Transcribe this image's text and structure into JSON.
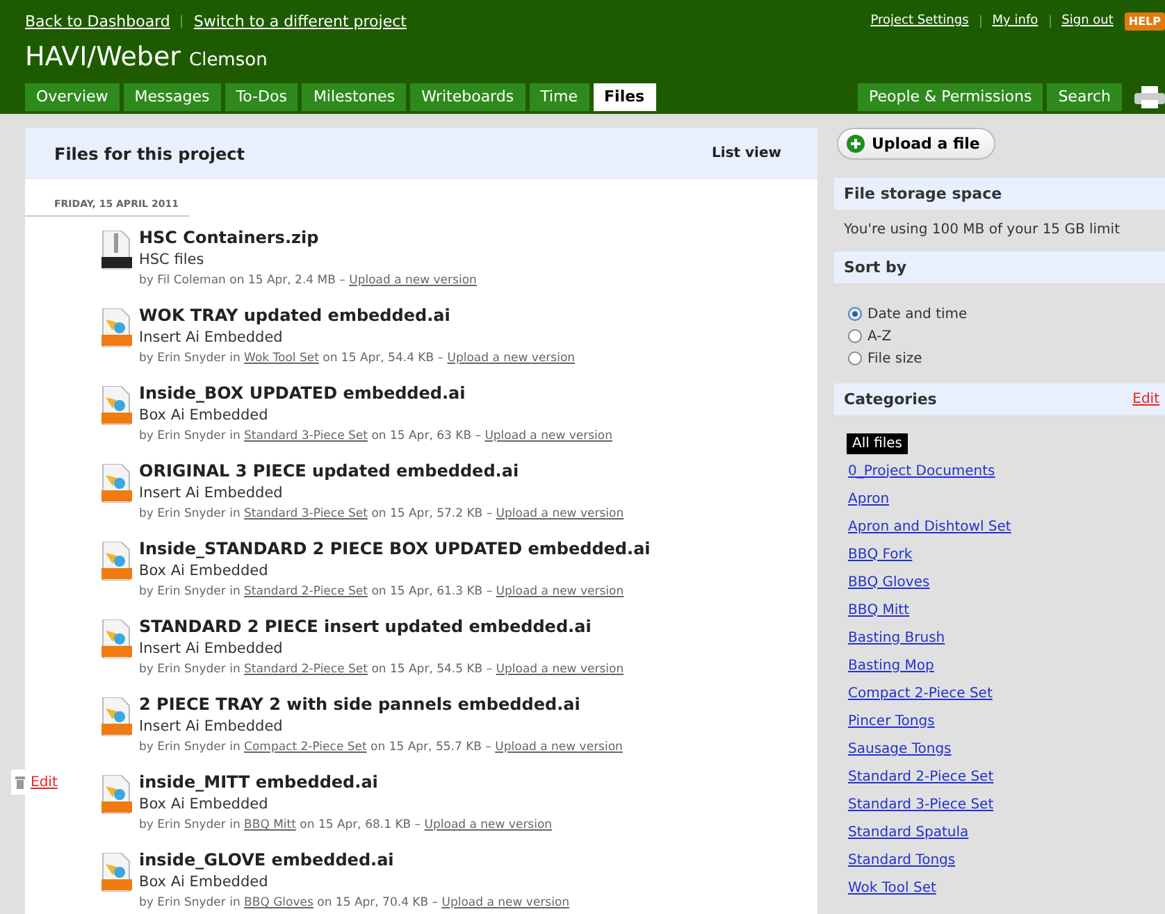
{
  "top_links": [
    "Back to Dashboard",
    "Switch to a different project"
  ],
  "account_links": [
    "Project Settings",
    "My info",
    "Sign out"
  ],
  "help_badge": "HELP",
  "project": {
    "title": "HAVI/Weber",
    "company": "Clemson"
  },
  "tabs": [
    {
      "label": "Overview",
      "selected": false
    },
    {
      "label": "Messages",
      "selected": false
    },
    {
      "label": "To-Dos",
      "selected": false
    },
    {
      "label": "Milestones",
      "selected": false
    },
    {
      "label": "Writeboards",
      "selected": false
    },
    {
      "label": "Time",
      "selected": false
    },
    {
      "label": "Files",
      "selected": true
    }
  ],
  "right_tabs": [
    {
      "label": "People & Permissions",
      "selected": false
    },
    {
      "label": "Search",
      "selected": false
    }
  ],
  "panel": {
    "title": "Files for this project",
    "view_link": "List view"
  },
  "date_heading": "FRIDAY, 15 APRIL 2011",
  "files": [
    {
      "kind": "zip",
      "name": "HSC Containers.zip",
      "description": "HSC files",
      "by": "by Fil Coleman",
      "details": "on 15 Apr, 2.4 MB –",
      "upload": "Upload a new version"
    },
    {
      "kind": "ai",
      "name": "WOK TRAY updated embedded.ai",
      "description": "Insert Ai Embedded",
      "by": "by Erin Snyder in",
      "category": "Wok Tool Set",
      "details": "on 15 Apr, 54.4 KB –",
      "upload": "Upload a new version"
    },
    {
      "kind": "ai",
      "name": "Inside_BOX UPDATED embedded.ai",
      "description": "Box Ai Embedded",
      "by": "by Erin Snyder in",
      "category": "Standard 3-Piece Set",
      "details": "on 15 Apr, 63 KB –",
      "upload": "Upload a new version"
    },
    {
      "kind": "ai",
      "name": "ORIGINAL 3 PIECE updated embedded.ai",
      "description": "Insert Ai Embedded",
      "by": "by Erin Snyder in",
      "category": "Standard 3-Piece Set",
      "details": "on 15 Apr, 57.2 KB –",
      "upload": "Upload a new version"
    },
    {
      "kind": "ai",
      "name": "Inside_STANDARD 2 PIECE BOX UPDATED embedded.ai",
      "description": "Box Ai Embedded",
      "by": "by Erin Snyder in",
      "category": "Standard 2-Piece Set",
      "details": "on 15 Apr, 61.3 KB –",
      "upload": "Upload a new version"
    },
    {
      "kind": "ai",
      "name": "STANDARD 2 PIECE insert updated embedded.ai",
      "description": "Insert Ai Embedded",
      "by": "by Erin Snyder in",
      "category": "Standard 2-Piece Set",
      "details": "on 15 Apr, 54.5 KB –",
      "upload": "Upload a new version"
    },
    {
      "kind": "ai",
      "name": "2 PIECE TRAY 2 with side pannels embedded.ai",
      "description": "Insert Ai Embedded",
      "by": "by Erin Snyder in",
      "category": "Compact 2-Piece Set",
      "details": "on 15 Apr, 55.7 KB –",
      "upload": "Upload a new version"
    },
    {
      "kind": "ai",
      "name": "inside_MITT embedded.ai",
      "description": "Box Ai Embedded",
      "by": "by Erin Snyder in",
      "category": "BBQ Mitt",
      "details": "on 15 Apr, 68.1 KB –",
      "upload": "Upload a new version",
      "edit_link": "Edit"
    },
    {
      "kind": "ai",
      "name": "inside_GLOVE embedded.ai",
      "description": "Box Ai Embedded",
      "by": "by Erin Snyder in",
      "category": "BBQ Gloves",
      "details": "on 15 Apr, 70.4 KB –",
      "upload": "Upload a new version"
    }
  ],
  "upload_button": "Upload a file",
  "storage": {
    "title": "File storage space",
    "text": "You're using 100 MB of your 15 GB limit"
  },
  "sort": {
    "title": "Sort by",
    "options": [
      {
        "label": "Date and time",
        "selected": true
      },
      {
        "label": "A-Z",
        "selected": false
      },
      {
        "label": "File size",
        "selected": false
      }
    ]
  },
  "categories": {
    "title": "Categories",
    "edit": "Edit",
    "items": [
      {
        "label": "All files",
        "selected": true
      },
      {
        "label": "0_Project Documents",
        "selected": false
      },
      {
        "label": "Apron",
        "selected": false
      },
      {
        "label": "Apron and Dishtowl Set",
        "selected": false
      },
      {
        "label": "BBQ Fork",
        "selected": false
      },
      {
        "label": "BBQ Gloves",
        "selected": false
      },
      {
        "label": "BBQ Mitt",
        "selected": false
      },
      {
        "label": "Basting Brush",
        "selected": false
      },
      {
        "label": "Basting Mop",
        "selected": false
      },
      {
        "label": "Compact 2-Piece Set",
        "selected": false
      },
      {
        "label": "Pincer Tongs",
        "selected": false
      },
      {
        "label": "Sausage Tongs",
        "selected": false
      },
      {
        "label": "Standard 2-Piece Set",
        "selected": false
      },
      {
        "label": "Standard 3-Piece Set",
        "selected": false
      },
      {
        "label": "Standard Spatula",
        "selected": false
      },
      {
        "label": "Standard Tongs",
        "selected": false
      },
      {
        "label": "Wok Tool Set",
        "selected": false
      }
    ]
  }
}
